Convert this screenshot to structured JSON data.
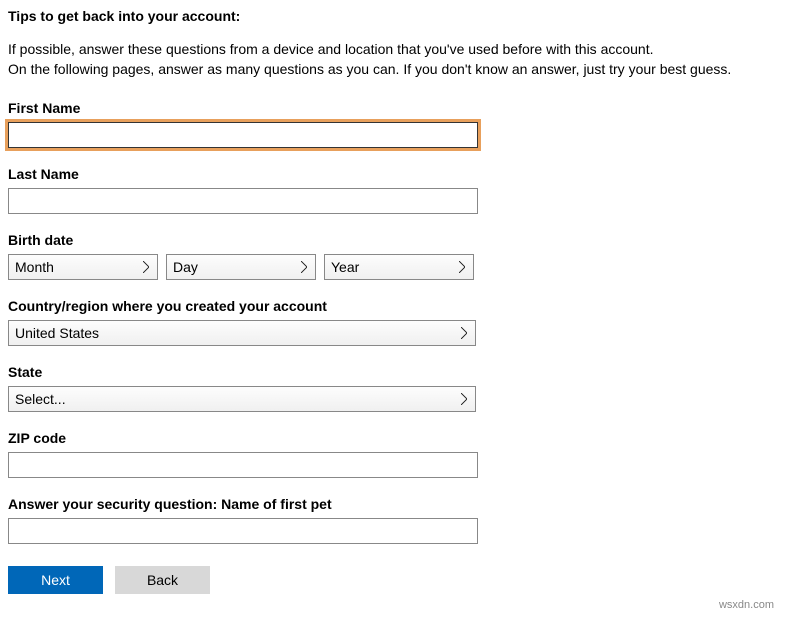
{
  "heading": "Tips to get back into your account:",
  "tip_line1": "If possible, answer these questions from a device and location that you've used before with this account.",
  "tip_line2": "On the following pages, answer as many questions as you can. If you don't know an answer, just try your best guess.",
  "labels": {
    "first_name": "First Name",
    "last_name": "Last Name",
    "birth_date": "Birth date",
    "country": "Country/region where you created your account",
    "state": "State",
    "zip": "ZIP code",
    "security_question": "Answer your security question: Name of first pet"
  },
  "values": {
    "first_name": "",
    "last_name": "",
    "zip": "",
    "security_answer": ""
  },
  "selects": {
    "month": "Month",
    "day": "Day",
    "year": "Year",
    "country": "United States",
    "state": "Select..."
  },
  "buttons": {
    "next": "Next",
    "back": "Back"
  },
  "watermark": "wsxdn.com"
}
